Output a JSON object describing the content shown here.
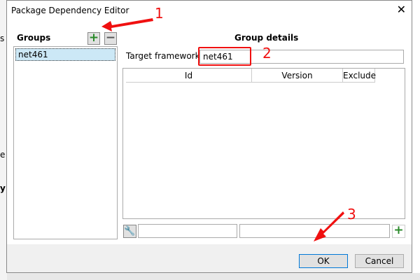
{
  "window": {
    "title": "Package Dependency Editor",
    "close": "✕"
  },
  "background": {
    "frag1": "s",
    "frag2": "e",
    "frag3": "y"
  },
  "groups": {
    "label": "Groups",
    "add": "+",
    "remove": "−",
    "items": [
      "net461"
    ]
  },
  "details": {
    "heading": "Group details",
    "target_label": "Target framework",
    "target_value": "net461",
    "columns": [
      "Id",
      "Version",
      "Exclude"
    ],
    "id_input": "",
    "version_input": "",
    "add": "+"
  },
  "buttons": {
    "ok": "OK",
    "cancel": "Cancel"
  },
  "annotations": [
    "1",
    "2",
    "3"
  ],
  "colors": {
    "annotation": "#f01010",
    "accent": "#0078d7"
  }
}
